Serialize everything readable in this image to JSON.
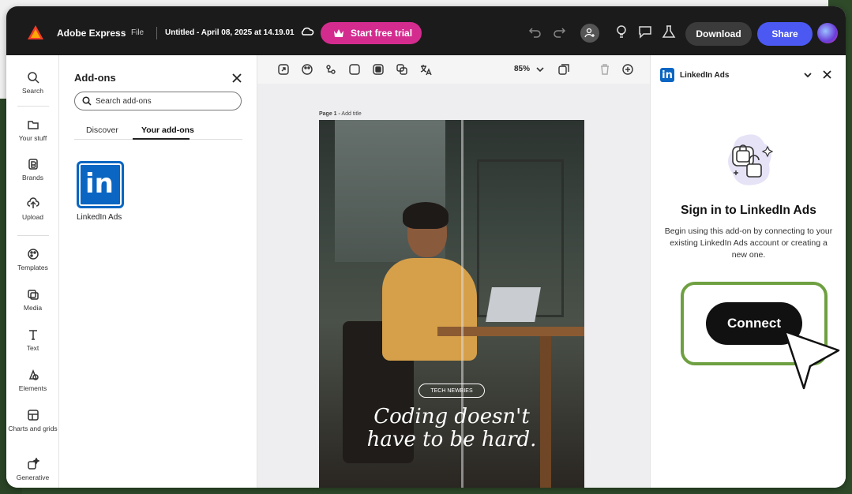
{
  "app": {
    "brand": "Adobe Express",
    "file_menu": "File",
    "document_title": "Untitled - April 08, 2025 at 14.19.01",
    "trial_button": "Start free trial",
    "download_button": "Download",
    "share_button": "Share",
    "accent_color": "#4b59f2",
    "trial_color": "#d42b8f"
  },
  "rail": {
    "items": [
      {
        "label": "Search",
        "icon": "search-icon"
      },
      {
        "label": "Your stuff",
        "icon": "folder-icon"
      },
      {
        "label": "Brands",
        "icon": "brand-icon"
      },
      {
        "label": "Upload",
        "icon": "upload-icon"
      },
      {
        "label": "Templates",
        "icon": "templates-icon"
      },
      {
        "label": "Media",
        "icon": "media-icon"
      },
      {
        "label": "Text",
        "icon": "text-icon"
      },
      {
        "label": "Elements",
        "icon": "elements-icon"
      },
      {
        "label": "Charts and grids",
        "icon": "charts-icon"
      },
      {
        "label": "Generative",
        "icon": "generative-icon"
      }
    ]
  },
  "addons": {
    "title": "Add-ons",
    "search_placeholder": "Search add-ons",
    "tabs": [
      "Discover",
      "Your add-ons"
    ],
    "active_tab": "Your add-ons",
    "installed": [
      {
        "name": "LinkedIn Ads",
        "icon": "linkedin-icon"
      }
    ]
  },
  "canvas": {
    "zoom": "85%",
    "page_label_prefix": "Page 1 -",
    "page_label_action": "Add title",
    "artboard": {
      "badge": "TECH NEWBIES",
      "headline_line1": "Coding doesn't",
      "headline_line2": "have to be hard."
    }
  },
  "linkedin_panel": {
    "title": "LinkedIn Ads",
    "heading": "Sign in to LinkedIn Ads",
    "description": "Begin using this add-on by connecting to your existing LinkedIn Ads account or creating a new one.",
    "connect_button": "Connect",
    "highlight_color": "#6ea041"
  }
}
